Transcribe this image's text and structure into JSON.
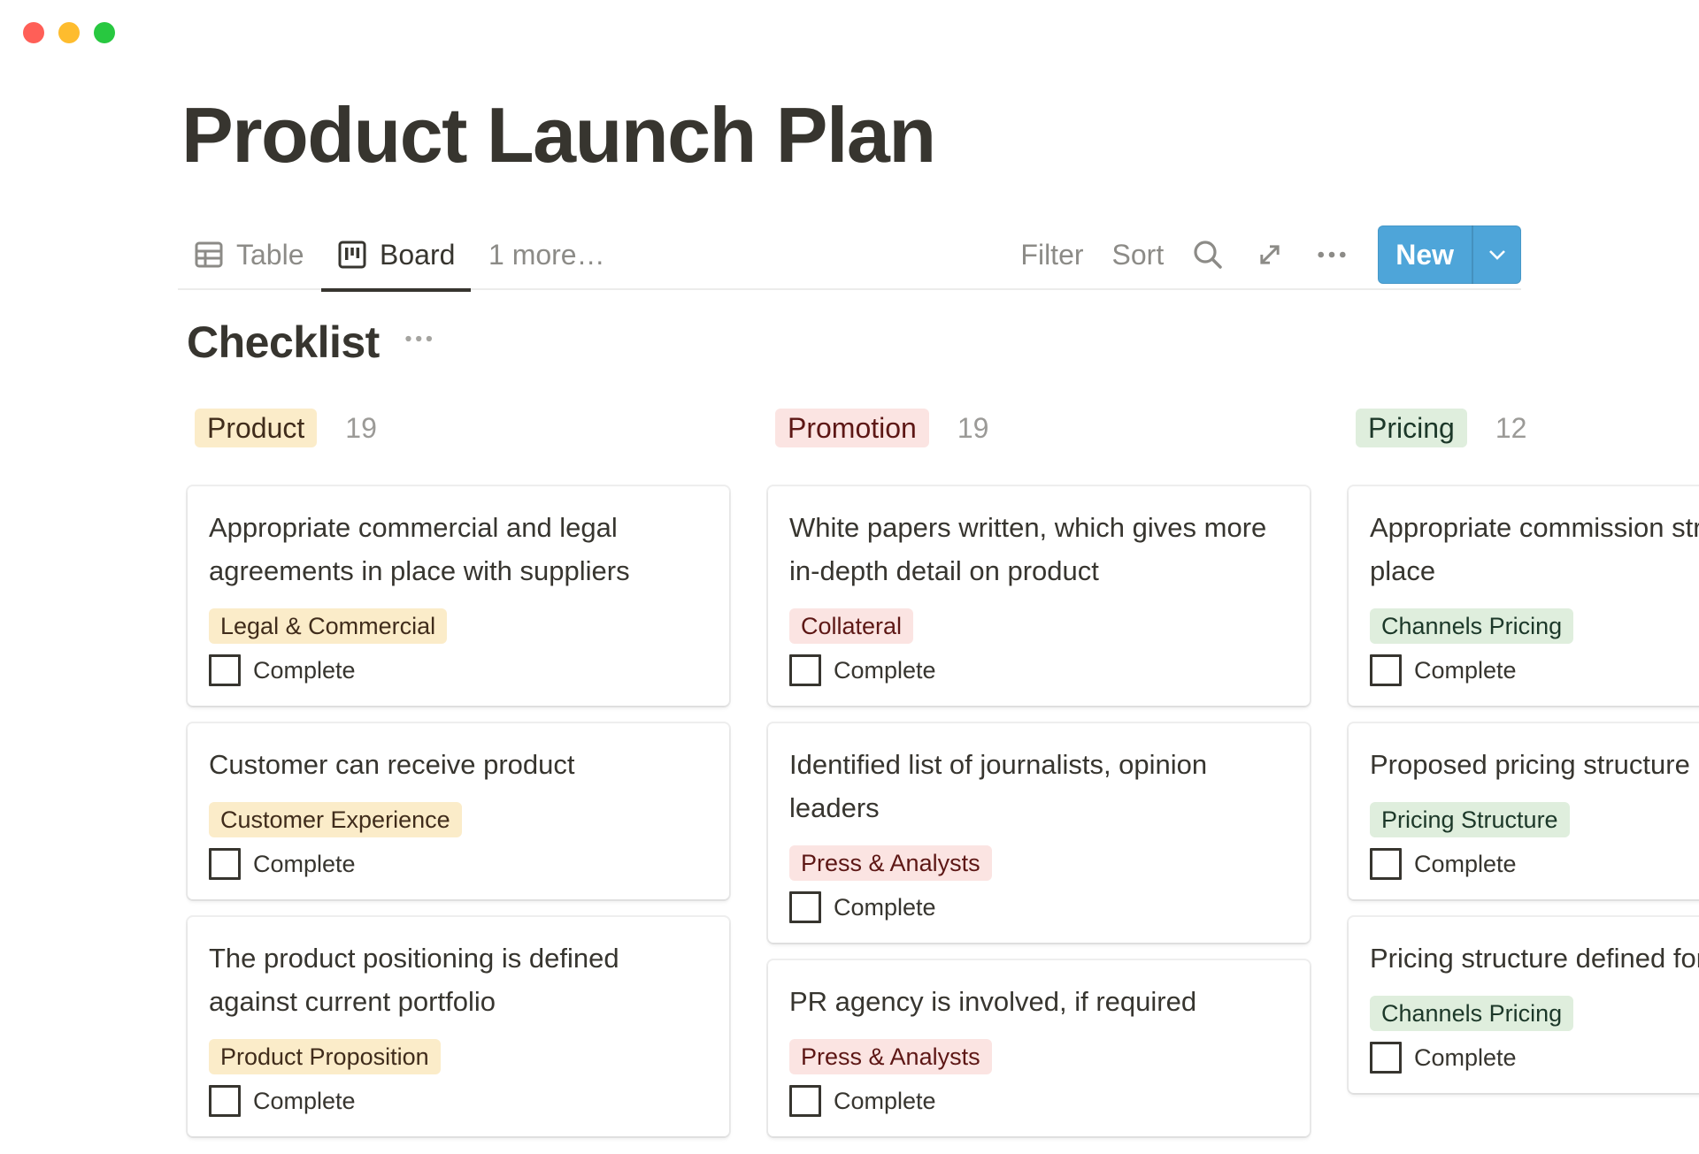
{
  "window": {
    "controls": [
      "close",
      "minimize",
      "maximize"
    ]
  },
  "page": {
    "title": "Product Launch Plan"
  },
  "views": {
    "tabs": [
      {
        "label": "Table",
        "icon": "table-icon",
        "active": false
      },
      {
        "label": "Board",
        "icon": "board-icon",
        "active": true
      },
      {
        "label": "1 more…",
        "active": false
      }
    ],
    "filter_label": "Filter",
    "sort_label": "Sort",
    "search_icon": "search-icon",
    "expand_icon": "expand-icon",
    "more_icon": "more-horizontal-icon",
    "new_label": "New",
    "new_caret_icon": "chevron-down-icon",
    "accent_color": "#4ea5d9"
  },
  "board": {
    "title": "Checklist",
    "columns": [
      {
        "label": "Product",
        "count": "19",
        "pill_bg": "#fbecc9",
        "pill_fg": "#402c1b",
        "cards": [
          {
            "title": "Appropriate commercial and legal agreements in place with suppliers",
            "tag": "Legal & Commercial",
            "checkbox_label": "Complete",
            "checked": false
          },
          {
            "title": "Customer can receive product",
            "tag": "Customer Experience",
            "checkbox_label": "Complete",
            "checked": false
          },
          {
            "title": "The product positioning is defined against current portfolio",
            "tag": "Product Proposition",
            "checkbox_label": "Complete",
            "checked": false
          }
        ]
      },
      {
        "label": "Promotion",
        "count": "19",
        "pill_bg": "#fbe4e2",
        "pill_fg": "#5d1715",
        "cards": [
          {
            "title": "White papers written, which gives more in-depth detail on product",
            "tag": "Collateral",
            "checkbox_label": "Complete",
            "checked": false
          },
          {
            "title": "Identified list of journalists, opinion leaders",
            "tag": "Press & Analysts",
            "checkbox_label": "Complete",
            "checked": false
          },
          {
            "title": "PR agency is involved, if required",
            "tag": "Press & Analysts",
            "checkbox_label": "Complete",
            "checked": false
          }
        ]
      },
      {
        "label": "Pricing",
        "count": "12",
        "pill_bg": "#dfeedd",
        "pill_fg": "#1c3829",
        "cards": [
          {
            "title": "Appropriate commission structure in place",
            "tag": "Channels Pricing",
            "checkbox_label": "Complete",
            "checked": false
          },
          {
            "title": "Proposed pricing structure",
            "tag": "Pricing Structure",
            "checkbox_label": "Complete",
            "checked": false
          },
          {
            "title": "Pricing structure defined for channels",
            "tag": "Channels Pricing",
            "checkbox_label": "Complete",
            "checked": false
          }
        ]
      }
    ]
  }
}
